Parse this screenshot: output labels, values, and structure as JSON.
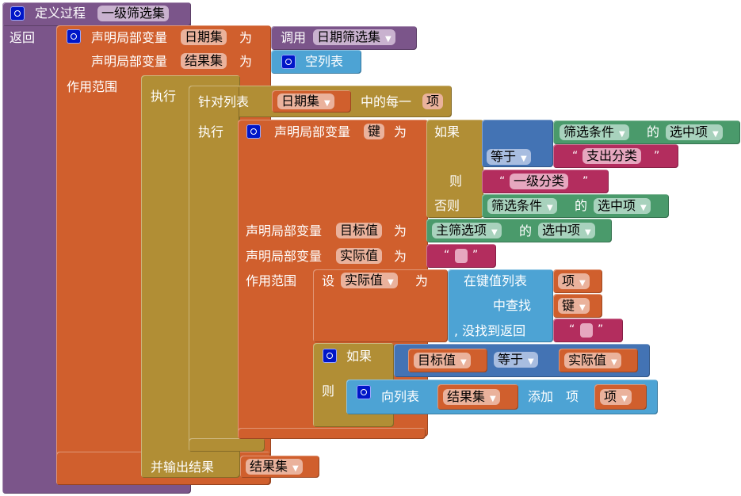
{
  "procedure": {
    "keyword": "定义过程",
    "name": "一级筛选集",
    "return_label": "返回"
  },
  "outer_local": {
    "declare_label": "声明局部变量",
    "as_label": "为",
    "var1_name": "日期集",
    "var1_value_call": "调用",
    "var1_value_proc": "日期筛选集",
    "var2_name": "结果集",
    "var2_value": "空列表",
    "scope_label": "作用范围"
  },
  "do_block": {
    "do_label": "执行",
    "result_label": "并输出结果",
    "result_var": "结果集"
  },
  "foreach": {
    "prefix": "针对列表",
    "list_var": "日期集",
    "middle": "中的每一",
    "item_name": "项",
    "do_label": "执行"
  },
  "inner_local": {
    "declare_label": "声明局部变量",
    "as_label": "为",
    "key_name": "键",
    "target_name": "目标值",
    "actual_name": "实际值",
    "scope_label": "作用范围"
  },
  "if_expr": {
    "if_label": "如果",
    "then_label": "则",
    "else_label": "否则",
    "cond_component": "筛选条件",
    "of_label": "的",
    "cond_property": "选中项",
    "compare_op": "等于",
    "compare_text": "支出分类",
    "then_text": "一级分类",
    "else_component": "筛选条件",
    "else_property": "选中项"
  },
  "target_value": {
    "component": "主筛选项",
    "of_label": "的",
    "property": "选中项"
  },
  "actual_value": {
    "text": ""
  },
  "set_block": {
    "set_label": "设",
    "var": "实际值",
    "to_label": "为",
    "lookup_label": "在键值列表",
    "lookup_list": "项",
    "find_label": "中查找",
    "find_key": "键",
    "notfound_label": ", 没找到返回",
    "notfound_value": ""
  },
  "if_stmt": {
    "if_label": "如果",
    "then_label": "则",
    "left_var": "目标值",
    "op": "等于",
    "right_var": "实际值"
  },
  "add_item": {
    "label": "向列表",
    "list_var": "结果集",
    "add_label": "添加",
    "item_label": "项",
    "item_var": "项"
  },
  "icons": {
    "mutator": "gear-icon",
    "dropdown": "▾",
    "quote_open": "“",
    "quote_close": "”"
  },
  "colors": {
    "procedure": "#7b558a",
    "variable": "#d05f2d",
    "control": "#b18e35",
    "list": "#4da3d4",
    "logic": "#4373b4",
    "component": "#4a9a6b",
    "text": "#b32d5e"
  }
}
